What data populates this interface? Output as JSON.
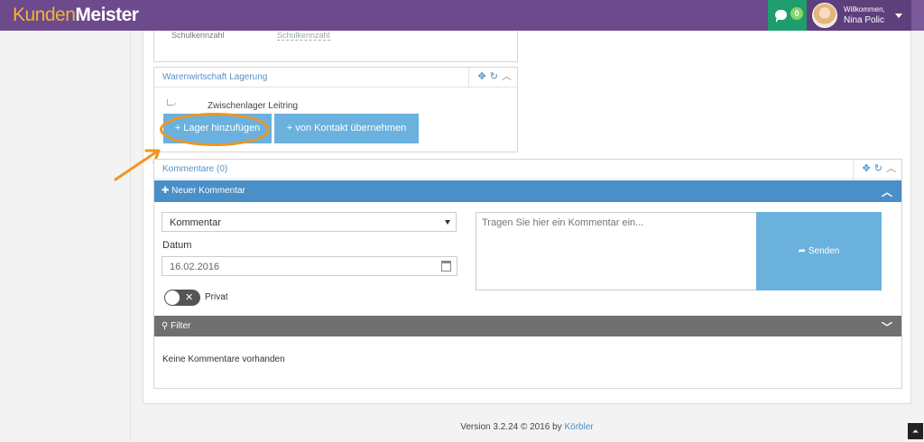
{
  "header": {
    "logo_part1": "Kunden",
    "logo_part2": "Meister",
    "chat_count": "0",
    "welcome": "Willkommen,",
    "username": "Nina Polic"
  },
  "top_panel": {
    "cut_label": "Schulkennzahl",
    "cut_value": "Schulkennzahl"
  },
  "lagerung": {
    "title": "Warenwirtschaft Lagerung",
    "tree_item": "Zwischenlager Leitring",
    "add_button": "+ Lager hinzufügen",
    "contact_button": "+ von Kontakt übernehmen"
  },
  "kommentare": {
    "title": "Kommentare (0)",
    "new_comment": "Neuer Kommentar",
    "type_value": "Kommentar",
    "datum_label": "Datum",
    "date_value": "16.02.2016",
    "privat_label": "Privat",
    "textarea_placeholder": "Tragen Sie hier ein Kommentar ein...",
    "send_label": "Senden",
    "filter_label": "Filter",
    "empty_text": "Keine Kommentare vorhanden"
  },
  "footer": {
    "version": "Version 3.2.24 © 2016 by ",
    "author": "Körbler"
  },
  "colors": {
    "topbar": "#6c4a8c",
    "accent_blue": "#4a8fc7",
    "button_blue": "#6bb1dd",
    "highlight": "#f0961e",
    "chat_green": "#1e9e6c"
  },
  "icons": {
    "move": "move-icon",
    "refresh": "refresh-icon",
    "collapse": "chevron-up-icon",
    "plus": "plus-icon",
    "share": "share-icon",
    "search": "search-icon",
    "calendar": "calendar-icon",
    "chat": "chat-icon"
  }
}
